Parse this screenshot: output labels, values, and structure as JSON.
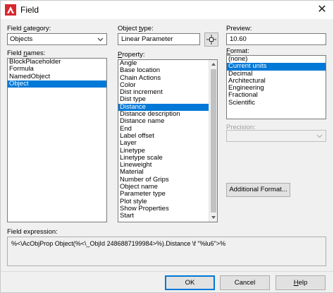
{
  "window": {
    "title": "Field",
    "close_glyph": "✕"
  },
  "field_category": {
    "label_pre": "Field ",
    "label_key": "c",
    "label_post": "ategory:",
    "value": "Objects"
  },
  "field_names": {
    "label_pre": "Field ",
    "label_key": "n",
    "label_post": "ames:",
    "items": [
      "BlockPlaceholder",
      "Formula",
      "NamedObject",
      "Object"
    ],
    "selected_index": 3
  },
  "object_type": {
    "label_pre": "Object ",
    "label_key": "t",
    "label_post": "ype:",
    "value": "Linear Parameter"
  },
  "property": {
    "label_pre": "",
    "label_key": "P",
    "label_post": "roperty:",
    "items": [
      "Angle",
      "Base location",
      "Chain Actions",
      "Color",
      "Dist increment",
      "Dist type",
      "Distance",
      "Distance description",
      "Distance name",
      "End",
      "Label offset",
      "Layer",
      "Linetype",
      "Linetype scale",
      "Lineweight",
      "Material",
      "Number of Grips",
      "Object name",
      "Parameter type",
      "Plot style",
      "Show Properties",
      "Start"
    ],
    "selected_index": 6
  },
  "preview": {
    "label": "Preview:",
    "value": "10.60"
  },
  "format": {
    "label_pre": "",
    "label_key": "F",
    "label_post": "ormat:",
    "items": [
      "(none)",
      "Current units",
      "Decimal",
      "Architectural",
      "Engineering",
      "Fractional",
      "Scientific"
    ],
    "selected_index": 1
  },
  "precision": {
    "label": "Precision:",
    "value": ""
  },
  "additional_format": {
    "label": "Additional Format..."
  },
  "field_expression": {
    "label": "Field expression:",
    "value": "%<\\AcObjProp Object(%<\\_ObjId 2486887199984>%).Distance \\f \"%lu6\">%"
  },
  "buttons": {
    "ok": "OK",
    "cancel": "Cancel",
    "help_pre": "",
    "help_key": "H",
    "help_post": "elp"
  },
  "colors": {
    "selection": "#0078d7",
    "accent_red": "#d7282f"
  }
}
